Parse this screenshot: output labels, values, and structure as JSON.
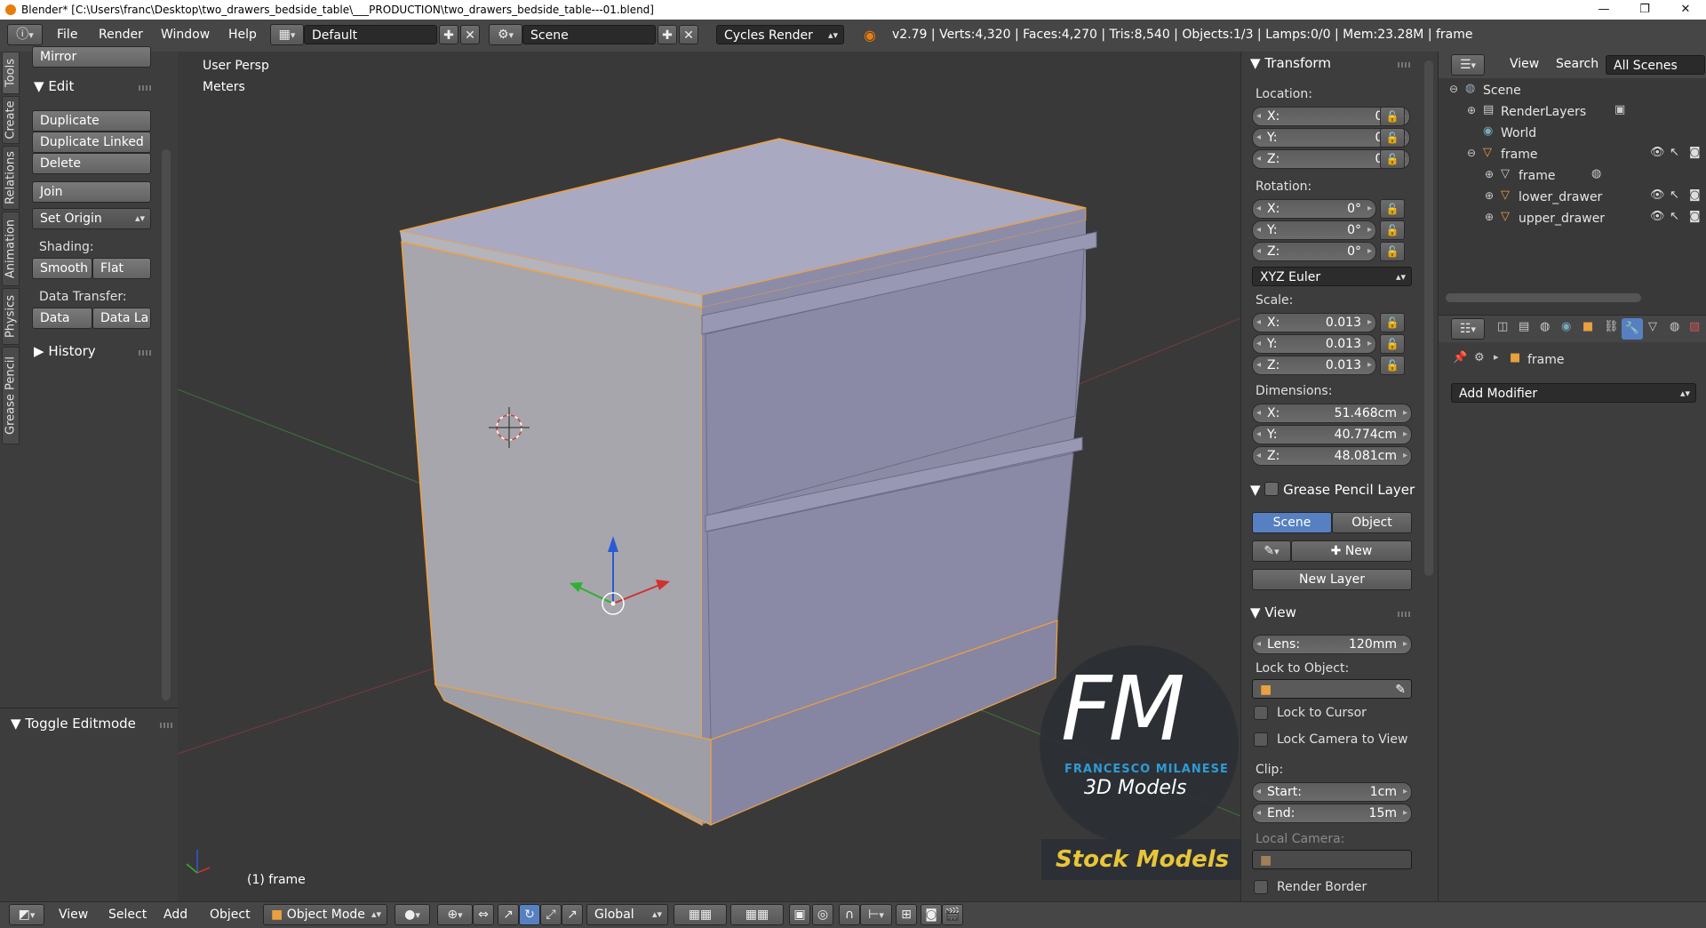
{
  "window": {
    "title": "Blender* [C:\\Users\\franc\\Desktop\\two_drawers_bedside_table\\___PRODUCTION\\two_drawers_bedside_table---01.blend]",
    "minimize": "—",
    "maximize": "❐",
    "close": "✕"
  },
  "header": {
    "menus": [
      "File",
      "Render",
      "Window",
      "Help"
    ],
    "layout": "Default",
    "scene": "Scene",
    "engine": "Cycles Render",
    "stats": "v2.79 | Verts:4,320 | Faces:4,270 | Tris:8,540 | Objects:1/3 | Lamps:0/0 | Mem:23.28M | frame"
  },
  "tabs": [
    "Tools",
    "Create",
    "Relations",
    "Animation",
    "Physics",
    "Grease Pencil"
  ],
  "toolshelf": {
    "mirror": "Mirror",
    "edit_title": "Edit",
    "duplicate": "Duplicate",
    "duplicate_linked": "Duplicate Linked",
    "delete": "Delete",
    "join": "Join",
    "set_origin": "Set Origin",
    "shading_label": "Shading:",
    "smooth": "Smooth",
    "flat": "Flat",
    "data_transfer_label": "Data Transfer:",
    "data": "Data",
    "data_la": "Data La",
    "history": "History",
    "toggle_editmode": "Toggle Editmode"
  },
  "viewport": {
    "view_name": "User Persp",
    "units": "Meters",
    "object_label": "(1) frame",
    "watermark_fm": "FM",
    "watermark_name": "FRANCESCO MILANESE",
    "watermark_sub": "3D Models",
    "watermark_stock": "Stock Models",
    "colors": {
      "background": "#393939",
      "mesh_top": "#a8a8c0",
      "mesh_front": "#8a8aa4",
      "mesh_side": "#9c9ca4",
      "selection": "#f0a040",
      "accent_blue": "#2e9bd6"
    }
  },
  "transform": {
    "title": "Transform",
    "location_label": "Location:",
    "location": [
      {
        "axis": "X:",
        "value": "0m"
      },
      {
        "axis": "Y:",
        "value": "0m"
      },
      {
        "axis": "Z:",
        "value": "0m"
      }
    ],
    "rotation_label": "Rotation:",
    "rotation": [
      {
        "axis": "X:",
        "value": "0°"
      },
      {
        "axis": "Y:",
        "value": "0°"
      },
      {
        "axis": "Z:",
        "value": "0°"
      }
    ],
    "rotation_mode": "XYZ Euler",
    "scale_label": "Scale:",
    "scale": [
      {
        "axis": "X:",
        "value": "0.013"
      },
      {
        "axis": "Y:",
        "value": "0.013"
      },
      {
        "axis": "Z:",
        "value": "0.013"
      }
    ],
    "dimensions_label": "Dimensions:",
    "dimensions": [
      {
        "axis": "X:",
        "value": "51.468cm"
      },
      {
        "axis": "Y:",
        "value": "40.774cm"
      },
      {
        "axis": "Z:",
        "value": "48.081cm"
      }
    ]
  },
  "grease_pencil": {
    "title": "Grease Pencil Layer",
    "scene": "Scene",
    "object": "Object",
    "new": "New",
    "new_layer": "New Layer"
  },
  "view_panel": {
    "title": "View",
    "lens_label": "Lens:",
    "lens_value": "120mm",
    "lock_to_object": "Lock to Object:",
    "lock_to_cursor": "Lock to Cursor",
    "lock_camera": "Lock Camera to View",
    "clip_label": "Clip:",
    "start_label": "Start:",
    "start_value": "1cm",
    "end_label": "End:",
    "end_value": "15m",
    "local_camera": "Local Camera:",
    "render_border": "Render Border"
  },
  "outliner": {
    "view": "View",
    "search": "Search",
    "all_scenes": "All Scenes",
    "items": [
      "Scene",
      "RenderLayers",
      "World",
      "frame",
      "frame",
      "lower_drawer",
      "upper_drawer"
    ]
  },
  "properties": {
    "object_name": "frame",
    "add_modifier": "Add Modifier"
  },
  "bottombar": {
    "menus": [
      "View",
      "Select",
      "Add",
      "Object"
    ],
    "mode": "Object Mode",
    "orientation": "Global"
  }
}
